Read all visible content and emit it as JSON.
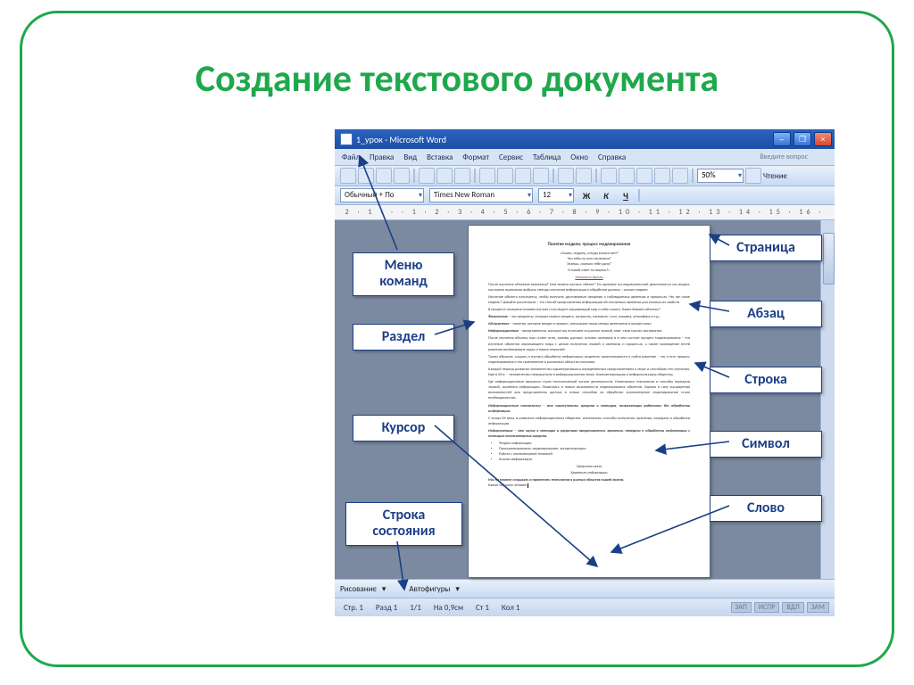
{
  "title": "Создание текстового документа",
  "window": {
    "caption": "1_урок - Microsoft Word"
  },
  "menu": {
    "items": [
      "Файл",
      "Правка",
      "Вид",
      "Вставка",
      "Формат",
      "Сервис",
      "Таблица",
      "Окно",
      "Справка"
    ],
    "ask": "Введите вопрос"
  },
  "format_bar": {
    "style": "Обычный + По",
    "font": "Times New Roman",
    "size": "12",
    "buttons": [
      "Ж",
      "К",
      "Ч"
    ],
    "zoom": "50%",
    "read": "Чтение"
  },
  "ruler": "2 · 1 · · · 1 · 2 · 3 · 4 · 5 · 6 · 7 · 8 · 9 · 10 · 11 · 12 · 13 · 14 · 15 · 16 ·",
  "draw_bar": {
    "label": "Рисование",
    "autoshapes": "Автофигуры"
  },
  "status": {
    "page": "Стр. 1",
    "section": "Разд 1",
    "pages": "1/1",
    "at": "На 0,9см",
    "line": "Ст 1",
    "col": "Кол 1",
    "indicators": [
      "ЗАП",
      "ИСПР",
      "ВДЛ",
      "ЗАМ"
    ]
  },
  "labels": {
    "left": [
      {
        "key": "menu_cmd",
        "text": "Меню\nкоманд"
      },
      {
        "key": "section",
        "text": "Раздел"
      },
      {
        "key": "cursor",
        "text": "Курсор"
      },
      {
        "key": "status_bar",
        "text": "Строка\nсостояния"
      }
    ],
    "right": [
      {
        "key": "page",
        "text": "Страница"
      },
      {
        "key": "paragraph",
        "text": "Абзац"
      },
      {
        "key": "line",
        "text": "Строка"
      },
      {
        "key": "symbol",
        "text": "Символ"
      },
      {
        "key": "word",
        "text": "Слово"
      }
    ]
  }
}
